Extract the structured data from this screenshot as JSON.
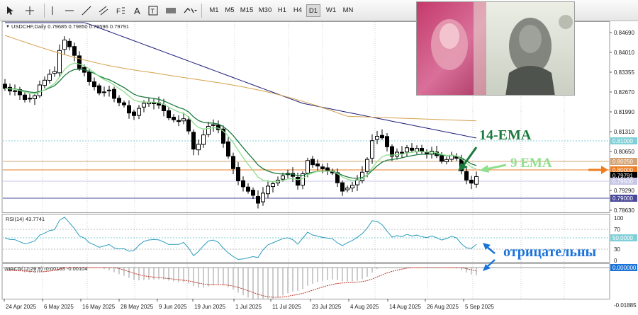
{
  "toolbar": {
    "timeframes": [
      "M1",
      "M5",
      "M15",
      "M30",
      "H1",
      "H4",
      "D1",
      "W1",
      "MN"
    ],
    "active_timeframe": "D1"
  },
  "chart": {
    "header": "USDCHF,Daily  0.79685 0.79850 0.79596 0.79791",
    "price_axis": [
      "0.84690",
      "0.84010",
      "0.83355",
      "0.82670",
      "0.81990",
      "0.81310",
      "0.80650",
      "0.79290",
      "0.78630"
    ],
    "price_markers": [
      {
        "label": "0.81000",
        "color": "#7fd0d8"
      },
      {
        "label": "0.80250",
        "color": "#d4a373"
      },
      {
        "label": "0.80000",
        "color": "#ee7d22"
      },
      {
        "label": "0.79791",
        "color": "#000000"
      },
      {
        "label": "0.79500",
        "color": "#c7c7e8"
      },
      {
        "label": "0.79000",
        "color": "#4a4a9a"
      }
    ],
    "date_axis": [
      "24 Apr 2025",
      "6 May 2025",
      "16 May 2025",
      "28 May 2025",
      "9 Jun 2025",
      "19 Jun 2025",
      "1 Jul 2025",
      "11 Jul 2025",
      "23 Jul 2025",
      "4 Aug 2025",
      "14 Aug 2025",
      "26 Aug 2025",
      "5 Sep 2025"
    ]
  },
  "rsi": {
    "header": "RSI(14) 43.7741",
    "axis": [
      "100",
      "70",
      "50.0000",
      "30",
      "0"
    ]
  },
  "macd": {
    "header": "MACD(12,26,9) -0.00103 -0.00104",
    "axis": [
      "0.000000",
      "-0.01885"
    ]
  },
  "annotations": {
    "ema14": "14-EMA",
    "ema9": "9 EMA",
    "negative": "отрицательны"
  },
  "colors": {
    "ema14": "#1a7a3c",
    "ema9": "#8ee08e",
    "callout_blue": "#1a73d9",
    "arrow_orange": "#ee7d22",
    "ma_slow": "#1c1c7a",
    "ma_mid": "#d4a24c"
  }
}
